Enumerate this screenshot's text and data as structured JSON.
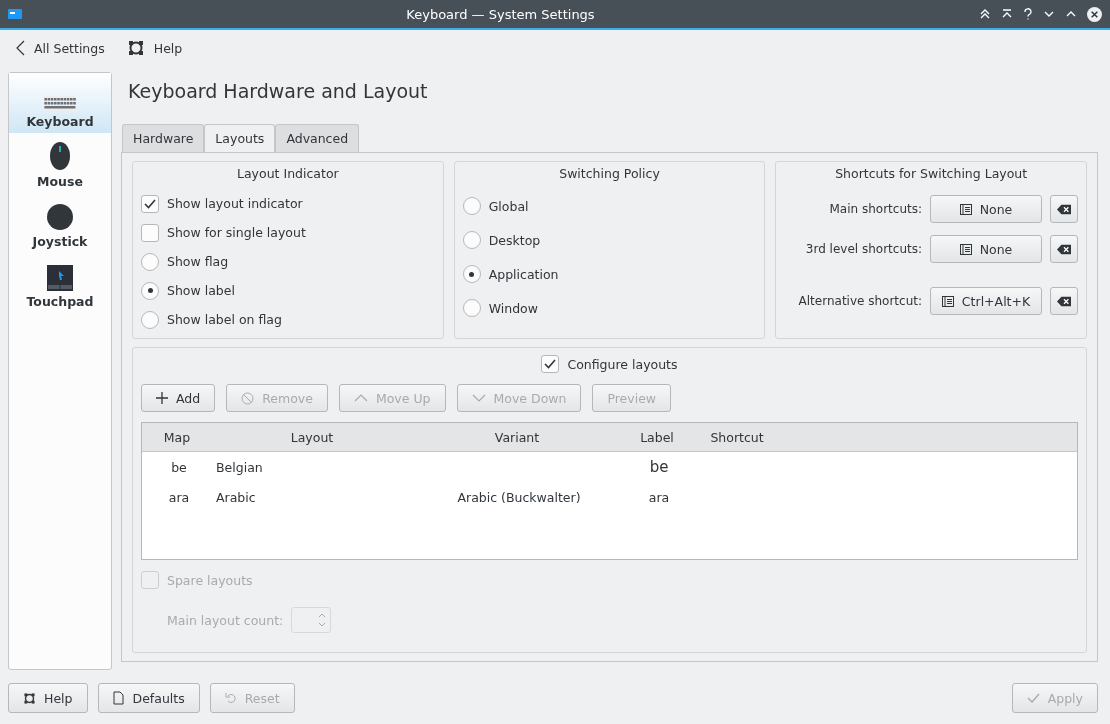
{
  "window": {
    "title": "Keyboard  — System Settings"
  },
  "nav": {
    "back": "All Settings",
    "help": "Help"
  },
  "sidebar": {
    "items": [
      {
        "label": "Keyboard",
        "kind": "keyboard",
        "selected": true
      },
      {
        "label": "Mouse",
        "kind": "mouse",
        "selected": false
      },
      {
        "label": "Joystick",
        "kind": "joystick",
        "selected": false
      },
      {
        "label": "Touchpad",
        "kind": "touchpad",
        "selected": false
      }
    ]
  },
  "page_title": "Keyboard Hardware and Layout",
  "tabs": [
    {
      "label": "Hardware",
      "selected": false
    },
    {
      "label": "Layouts",
      "selected": true
    },
    {
      "label": "Advanced",
      "selected": false
    }
  ],
  "layout_indicator": {
    "title": "Layout Indicator",
    "options": [
      {
        "kind": "checkbox",
        "label": "Show layout indicator",
        "checked": true
      },
      {
        "kind": "checkbox",
        "label": "Show for single layout",
        "checked": false
      },
      {
        "kind": "radio",
        "label": "Show flag",
        "selected": false
      },
      {
        "kind": "radio",
        "label": "Show label",
        "selected": true
      },
      {
        "kind": "radio",
        "label": "Show label on flag",
        "selected": false
      }
    ]
  },
  "switching_policy": {
    "title": "Switching Policy",
    "options": [
      {
        "label": "Global",
        "selected": false
      },
      {
        "label": "Desktop",
        "selected": false
      },
      {
        "label": "Application",
        "selected": true
      },
      {
        "label": "Window",
        "selected": false
      }
    ]
  },
  "shortcuts": {
    "title": "Shortcuts for Switching Layout",
    "rows": [
      {
        "label": "Main shortcuts:",
        "value": "None"
      },
      {
        "label": "3rd level shortcuts:",
        "value": "None"
      },
      {
        "label": "Alternative shortcut:",
        "value": "Ctrl+Alt+K"
      }
    ]
  },
  "configure_layouts": {
    "label": "Configure layouts",
    "checked": true
  },
  "toolbar": [
    {
      "label": "Add",
      "kind": "add",
      "disabled": false
    },
    {
      "label": "Remove",
      "kind": "remove",
      "disabled": true
    },
    {
      "label": "Move Up",
      "kind": "up",
      "disabled": true
    },
    {
      "label": "Move Down",
      "kind": "down",
      "disabled": true
    },
    {
      "label": "Preview",
      "kind": "plain",
      "disabled": true
    }
  ],
  "table": {
    "columns": [
      "Map",
      "Layout",
      "Variant",
      "Label",
      "Shortcut"
    ],
    "rows": [
      {
        "map": "be",
        "layout": "Belgian",
        "variant": "",
        "label": "be"
      },
      {
        "map": "ara",
        "layout": "Arabic",
        "variant": "Arabic (Buckwalter)",
        "label": "ara"
      }
    ]
  },
  "spare_layouts": {
    "label": "Spare layouts",
    "checked": false,
    "disabled": true
  },
  "main_layout_count": {
    "label": "Main layout count:",
    "disabled": true
  },
  "footer": [
    {
      "label": "Help",
      "kind": "help",
      "disabled": false
    },
    {
      "label": "Defaults",
      "kind": "defaults",
      "disabled": false
    },
    {
      "label": "Reset",
      "kind": "reset",
      "disabled": true
    },
    {
      "label": "Apply",
      "kind": "apply",
      "disabled": true
    }
  ]
}
